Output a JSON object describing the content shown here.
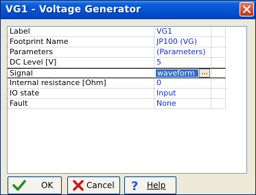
{
  "window": {
    "title": "VG1 - Voltage Generator"
  },
  "properties": [
    {
      "name": "Label",
      "value": "VG1"
    },
    {
      "name": "Footprint Name",
      "value": "JP100 (VG)"
    },
    {
      "name": "Parameters",
      "value": "(Parameters)"
    },
    {
      "name": "DC Level [V]",
      "value": "5"
    },
    {
      "name": "Signal",
      "value": "waveform",
      "selected": true
    },
    {
      "name": "Internal resistance [Ohm]",
      "value": "0"
    },
    {
      "name": "IO state",
      "value": "Input"
    },
    {
      "name": "Fault",
      "value": "None"
    }
  ],
  "editor": {
    "ellipsis_label": "..."
  },
  "buttons": {
    "ok": "OK",
    "cancel": "Cancel",
    "help": "Help"
  },
  "colors": {
    "titlebar": "#0654d0",
    "value_text": "#1030c8",
    "selection": "#316ac5",
    "close": "#c4300c"
  }
}
